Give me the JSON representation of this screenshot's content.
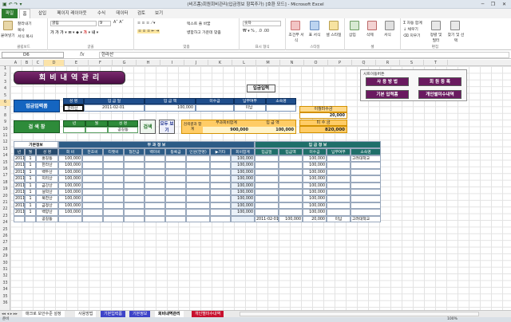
{
  "window": {
    "title": "(비즈폼)회원회비관리(입금정보 항목추가) [호환 모드] - Microsoft Excel",
    "minimize": "─",
    "restore": "❐",
    "close": "✕"
  },
  "ribbon_tabs": [
    "파일",
    "홈",
    "삽입",
    "페이지 레이아웃",
    "수식",
    "데이터",
    "검토",
    "보기"
  ],
  "ribbon": {
    "paste": "붙여넣기",
    "cut": "잘라내기",
    "copy": "복사",
    "format_painter": "서식 복사",
    "clipboard_label": "클립보드",
    "font_name": "굴림",
    "font_size": "9",
    "font_label": "글꼴",
    "wrap": "텍스트 줄 바꿈",
    "merge": "병합하고 가운데 맞춤",
    "align_label": "맞춤",
    "number_format": "숫자",
    "number_label": "표시 형식",
    "cond_format": "조건부 서식",
    "table_format": "표 서식",
    "cell_style": "셀 스타일",
    "style_label": "스타일",
    "insert": "삽입",
    "delete": "삭제",
    "format": "서식",
    "cells_label": "셀",
    "autosum": "자동 합계",
    "fill": "채우기",
    "clear": "지우기",
    "sort": "정렬 및 필터",
    "find": "찾기 및 선택",
    "edit_label": "편집"
  },
  "formula_bar": {
    "name_box": "D6",
    "fx": "fx",
    "value": "한라산"
  },
  "columns": [
    "A",
    "B",
    "C",
    "D",
    "E",
    "F",
    "G",
    "H",
    "I",
    "J",
    "K",
    "L",
    "M",
    "N",
    "O",
    "P",
    "Q",
    "R",
    "S",
    "T"
  ],
  "rows": [
    "1",
    "2",
    "3",
    "4",
    "5",
    "6",
    "7",
    "8",
    "9",
    "10",
    "11",
    "12",
    "13",
    "14",
    "15",
    "16",
    "17",
    "18",
    "19",
    "20",
    "21",
    "22",
    "23",
    "24",
    "25",
    "26",
    "27",
    "28",
    "29",
    "30",
    "31",
    "32",
    "33",
    "34",
    "35",
    "36"
  ],
  "sheet": {
    "title": "회 비 내 역 관 리",
    "btn_payment": "입금입력",
    "shortcut_label": "시트이동버튼",
    "btn_usage": "사 용 방 법",
    "btn_member": "회 원 등 록",
    "btn_default_payment": "기본 입력폼",
    "btn_personal": "개인별미수내역",
    "form_label": "입금입력폼",
    "form_headers": [
      "성 명",
      "입 금 일",
      "입 금 액",
      "미수금",
      "납부여부",
      "소속명"
    ],
    "form_values": [
      "한라산",
      "2011-02-01",
      "100,000",
      "",
      "미납",
      ""
    ],
    "search_label": "검 색 창",
    "search_headers": [
      "년",
      "월",
      "성 명"
    ],
    "search_values": [
      "",
      "",
      "공길동"
    ],
    "btn_search": "검색",
    "btn_show_all": "모두 보기",
    "result_label": "검색결과 합 계",
    "result_headers": [
      "부과회비합계",
      "입 금 액"
    ],
    "result_values": [
      "900,000",
      "100,000"
    ],
    "unpaid_prev_label": "이월미수금",
    "unpaid_prev_value": "20,000",
    "unpaid_label": "미 수 금",
    "unpaid_value": "820,000",
    "basic_info": "기본정보",
    "charge_info": "부 과 정 보",
    "payment_info": "입 금 정 보",
    "table_headers": [
      "년",
      "월",
      "성 명",
      "회 비",
      "찬조비",
      "티켓비",
      "협찬금",
      "백미비",
      "등록금",
      "인원(한명)",
      "▶기타",
      "회비합계",
      "입금일",
      "입금액",
      "미수금",
      "납부여부",
      "소속명"
    ],
    "rows": [
      {
        "y": "2011",
        "m": "1",
        "name": "홍길동",
        "fee": "100,000",
        "total": "100,000",
        "pdate": "",
        "pamt": "",
        "unpaid": "100,000",
        "status": "",
        "org": "고려대학교"
      },
      {
        "y": "2011",
        "m": "1",
        "name": "한라산",
        "fee": "100,000",
        "total": "100,000",
        "pdate": "",
        "pamt": "",
        "unpaid": "100,000",
        "status": "",
        "org": ""
      },
      {
        "y": "2011",
        "m": "1",
        "name": "백두산",
        "fee": "100,000",
        "total": "100,000",
        "pdate": "",
        "pamt": "",
        "unpaid": "100,000",
        "status": "",
        "org": ""
      },
      {
        "y": "2011",
        "m": "1",
        "name": "지리산",
        "fee": "100,000",
        "total": "100,000",
        "pdate": "",
        "pamt": "",
        "unpaid": "100,000",
        "status": "",
        "org": ""
      },
      {
        "y": "2011",
        "m": "1",
        "name": "금강산",
        "fee": "100,000",
        "total": "100,000",
        "pdate": "",
        "pamt": "",
        "unpaid": "100,000",
        "status": "",
        "org": ""
      },
      {
        "y": "2011",
        "m": "1",
        "name": "설악산",
        "fee": "100,000",
        "total": "100,000",
        "pdate": "",
        "pamt": "",
        "unpaid": "100,000",
        "status": "",
        "org": ""
      },
      {
        "y": "2011",
        "m": "1",
        "name": "북한산",
        "fee": "100,000",
        "total": "100,000",
        "pdate": "",
        "pamt": "",
        "unpaid": "100,000",
        "status": "",
        "org": ""
      },
      {
        "y": "2011",
        "m": "1",
        "name": "금정산",
        "fee": "100,000",
        "total": "100,000",
        "pdate": "",
        "pamt": "",
        "unpaid": "100,000",
        "status": "",
        "org": ""
      },
      {
        "y": "2011",
        "m": "1",
        "name": "백양산",
        "fee": "100,000",
        "total": "100,000",
        "pdate": "",
        "pamt": "",
        "unpaid": "100,000",
        "status": "",
        "org": ""
      },
      {
        "y": "",
        "m": "",
        "name": "공길동",
        "fee": "",
        "total": "",
        "pdate": "2011-02-01",
        "pamt": "100,000",
        "unpaid": "20,000",
        "status": "미납",
        "org": "고려대학교"
      }
    ]
  },
  "sheet_tabs": [
    "매크로 보안수준 설정",
    "사용방법",
    "기본입력폼",
    "기본정보",
    "회비내역관리",
    "개인별미수내역"
  ],
  "status": {
    "ready": "준비",
    "zoom": "100%"
  },
  "colors": {
    "accent": "#2d7d2e",
    "header_blue": "#2d5c86",
    "button_purple": "#6a1a60",
    "form_blue": "#1565c0",
    "unpaid_orange": "#ffcc66"
  }
}
